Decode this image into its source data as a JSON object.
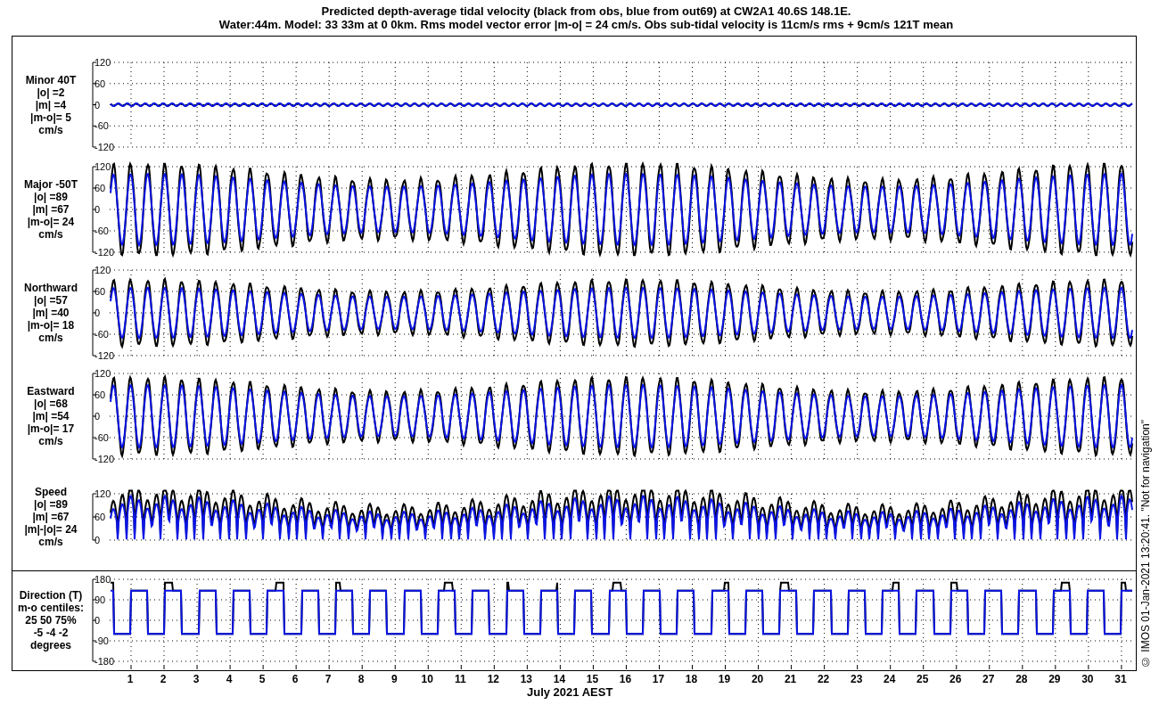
{
  "title": [
    "Predicted depth-average tidal velocity (black from obs, blue from out69) at CW2A1 40.6S 148.1E.",
    "Water:44m. Model: 33 33m at 0 0km. Rms model vector error |m-o| = 24 cm/s. Obs sub-tidal velocity is 11cm/s rms + 9cm/s 121T mean"
  ],
  "panels": [
    {
      "kind": "signed",
      "label_lines": [
        "Minor 40T",
        "|o| =2",
        "|m| =4",
        "|m-o|= 5",
        "cm/s"
      ],
      "yticks": [
        "120",
        "60",
        "0",
        "-60",
        "-120"
      ]
    },
    {
      "kind": "signed",
      "label_lines": [
        "Major -50T",
        "|o| =89",
        "|m| =67",
        "|m-o|= 24",
        "cm/s"
      ],
      "yticks": [
        "120",
        "60",
        "0",
        "-60",
        "-120"
      ]
    },
    {
      "kind": "signed",
      "label_lines": [
        "Northward",
        "|o| =57",
        "|m| =40",
        "|m-o|= 18",
        "cm/s"
      ],
      "yticks": [
        "120",
        "60",
        "0",
        "-60",
        "-120"
      ]
    },
    {
      "kind": "signed",
      "label_lines": [
        "Eastward",
        "|o| =68",
        "|m| =54",
        "|m-o|= 17",
        "cm/s"
      ],
      "yticks": [
        "120",
        "60",
        "0",
        "-60",
        "-120"
      ]
    },
    {
      "kind": "speed",
      "label_lines": [
        "Speed",
        "|o| =89",
        "|m| =67",
        "|m|-|o|= 24",
        "cm/s"
      ],
      "yticks": [
        "120",
        "60",
        "0"
      ]
    },
    {
      "kind": "direction",
      "label_lines": [
        "Direction (T)",
        "m-o centiles:",
        "25  50  75%",
        "-5 -4 -2",
        "degrees"
      ],
      "yticks": [
        "180",
        "90",
        "0",
        "-90",
        "-180"
      ]
    }
  ],
  "x_axis": {
    "ticks": [
      "1",
      "2",
      "3",
      "4",
      "5",
      "6",
      "7",
      "8",
      "9",
      "10",
      "11",
      "12",
      "13",
      "14",
      "15",
      "16",
      "17",
      "18",
      "19",
      "20",
      "21",
      "22",
      "23",
      "24",
      "25",
      "26",
      "27",
      "28",
      "29",
      "30",
      "31"
    ],
    "label": "July 2021 AEST"
  },
  "credit": "© IMOS 01-Jan-2021 13:20:41. \"Not for navigation\""
}
